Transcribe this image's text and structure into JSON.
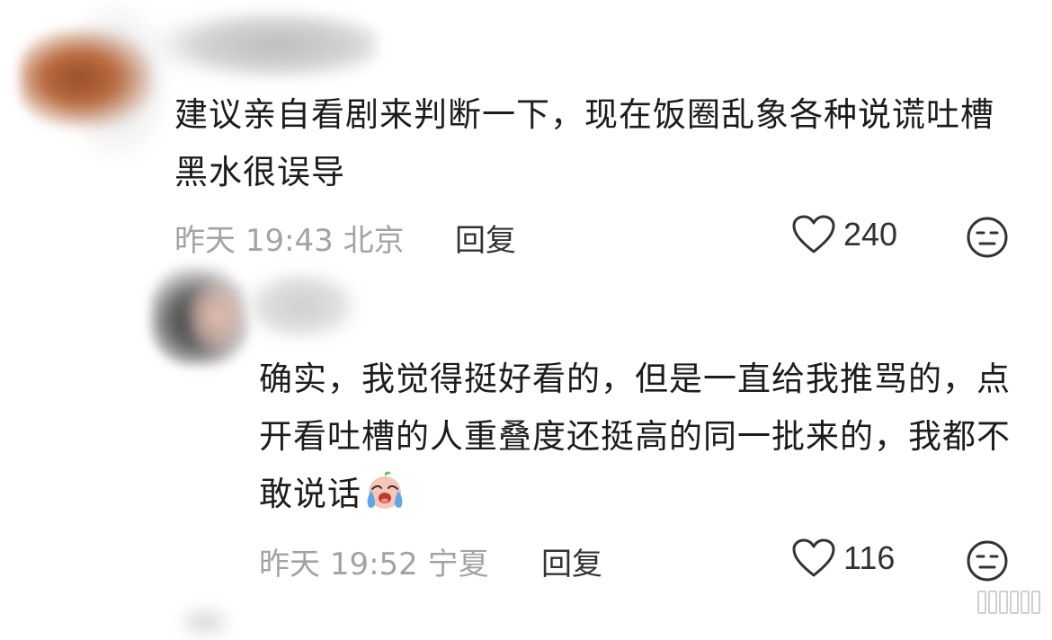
{
  "comments": [
    {
      "text": "建议亲自看剧来判断一下，现在饭圈乱象各种说谎吐槽黑水很误导",
      "date": "昨天",
      "time": "19:43",
      "location": "北京",
      "reply_label": "回复",
      "like_count": "240",
      "like_icon": "heart-outline-icon",
      "dislike_icon": "meh-face-icon"
    },
    {
      "text": "确实，我觉得挺好看的，但是一直给我推骂的，点开看吐槽的人重叠度还挺高的同一批来的，我都不敢说话",
      "emoji": "crying-face-emoji",
      "date": "昨天",
      "time": "19:52",
      "location": "宁夏",
      "reply_label": "回复",
      "like_count": "116",
      "like_icon": "heart-outline-icon",
      "dislike_icon": "meh-face-icon"
    }
  ],
  "colors": {
    "text": "#1c1c1c",
    "meta": "#a3a3a3",
    "action": "#333333",
    "emoji_face": "#f6c6b8",
    "emoji_tears": "#5aa9e6"
  }
}
